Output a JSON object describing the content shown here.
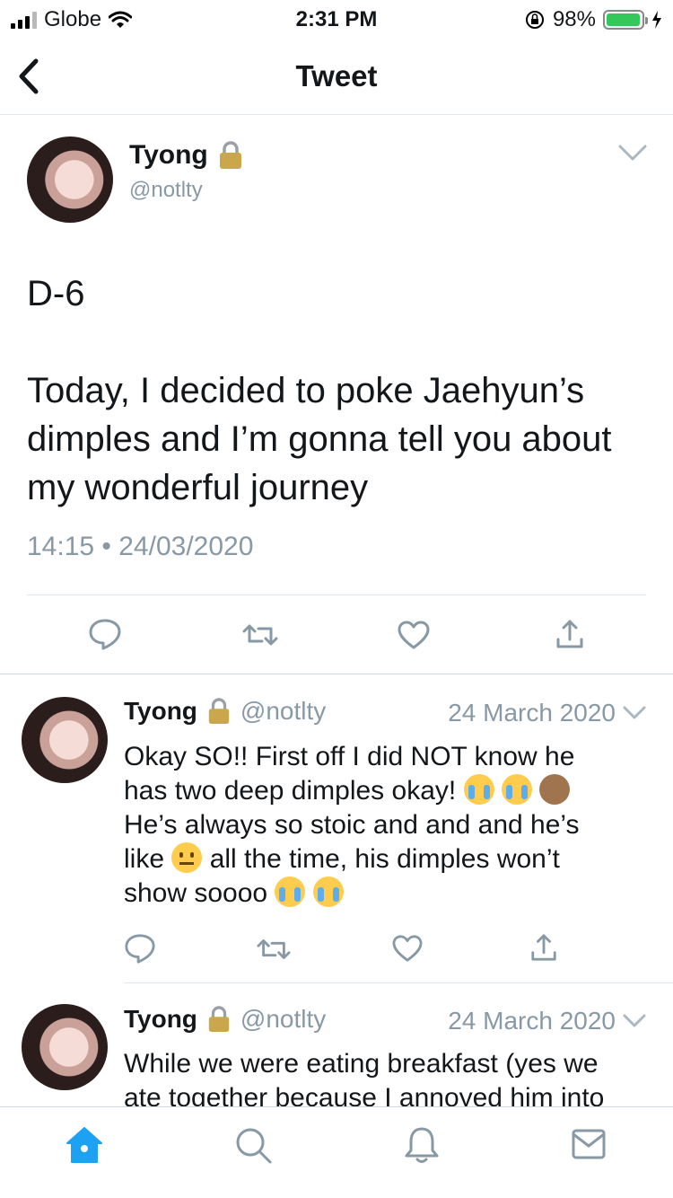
{
  "status_bar": {
    "carrier": "Globe",
    "time": "2:31 PM",
    "battery": "98%",
    "battery_level": 0.98,
    "colors": {
      "battery": "#34c759"
    }
  },
  "nav": {
    "title": "Tweet"
  },
  "main_tweet": {
    "name": "Tyong",
    "handle": "@notlty",
    "text_lines": [
      "D-6",
      "",
      "Today, I decided to poke Jaehyun’s",
      "dimples and I’m gonna tell you about",
      "my wonderful journey"
    ],
    "timestamp": "14:15 • 24/03/2020"
  },
  "replies": [
    {
      "name": "Tyong",
      "handle": "@notlty",
      "date": "24 March 2020",
      "line1": "Okay SO!! First off I did NOT know he",
      "line2": "has two deep dimples okay!",
      "line3": "He’s always so stoic and and and he’s",
      "line4a": "like",
      "line4b": "all the time, his dimples won’t",
      "line5": "show soooo"
    },
    {
      "name": "Tyong",
      "handle": "@notlty",
      "date": "24 March 2020",
      "line1": "While we were eating breakfast (yes we",
      "line2": "ate together because I annoyed him into"
    }
  ],
  "icons": {
    "reply": "reply-icon",
    "retweet": "retweet-icon",
    "like": "heart-icon",
    "share": "share-icon",
    "home": "home-icon",
    "search": "search-icon",
    "notifications": "bell-icon",
    "messages": "mail-icon",
    "lock": "lock-icon"
  },
  "colors": {
    "accent": "#1da1f2",
    "secondary_text": "#8899a6"
  }
}
